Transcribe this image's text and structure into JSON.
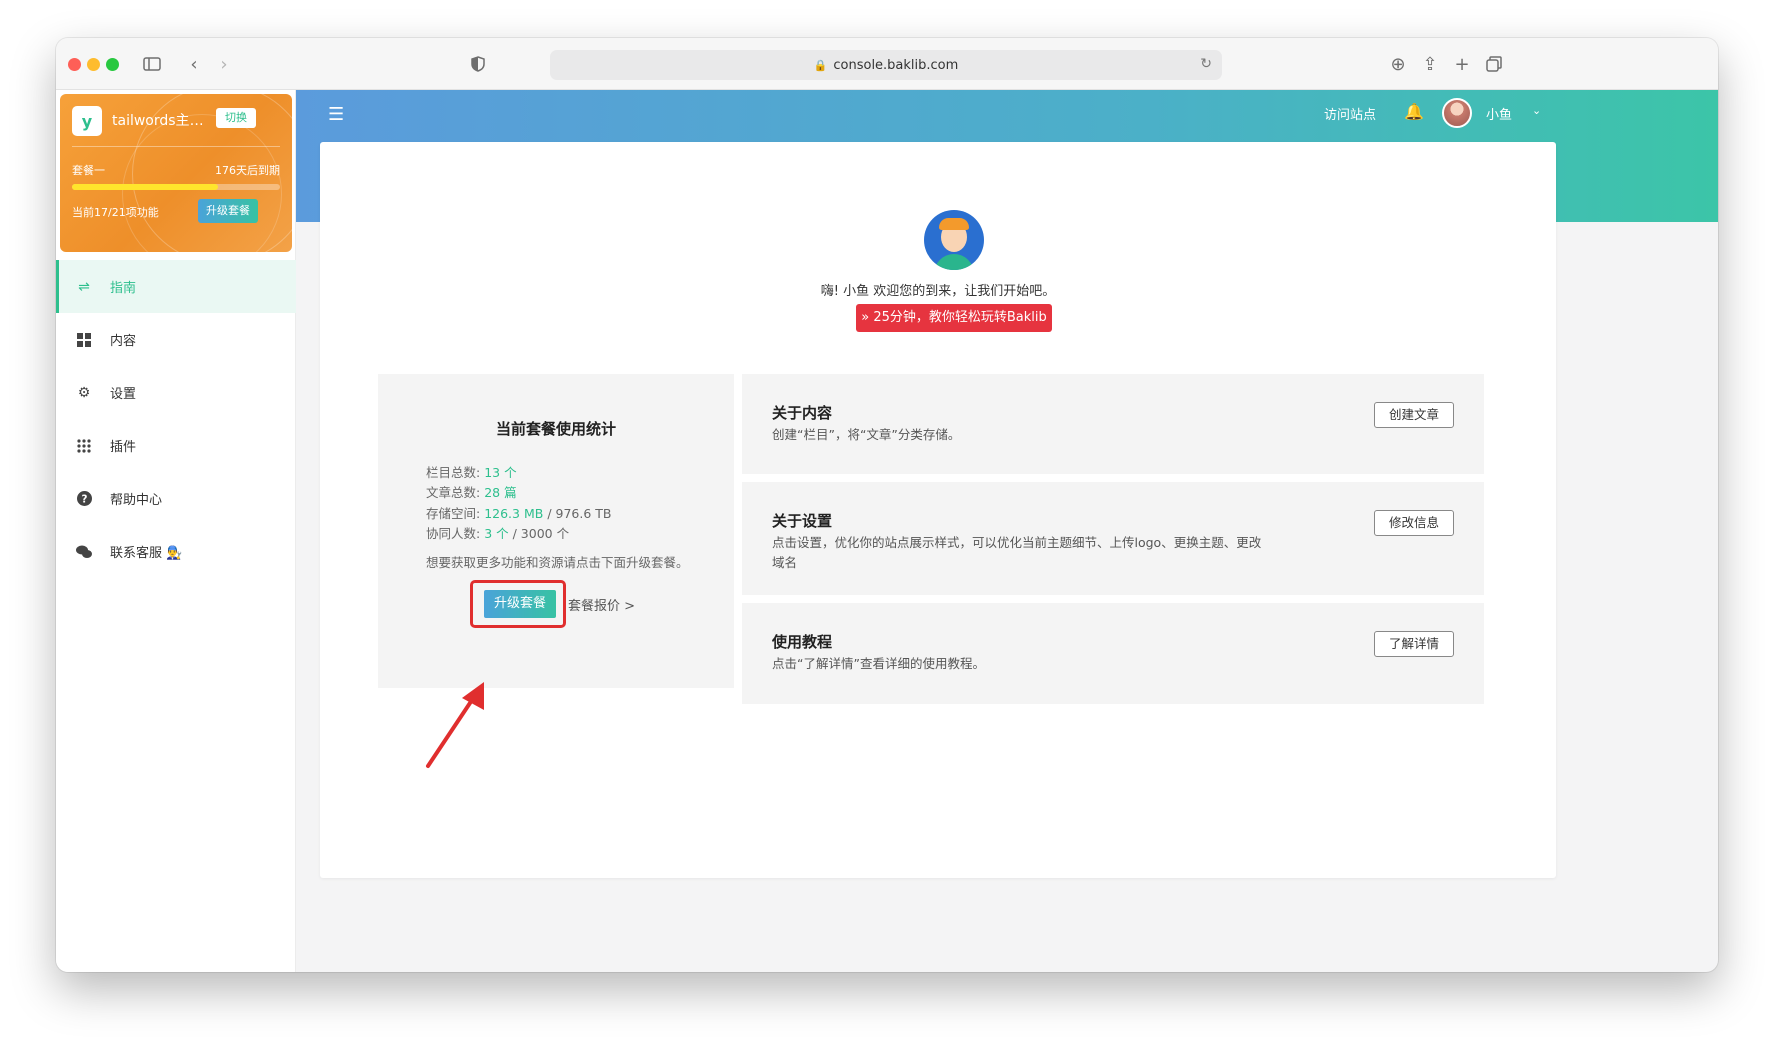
{
  "browser": {
    "url": "console.baklib.com"
  },
  "sidebar": {
    "site": {
      "logo_text": "y",
      "name": "tailwords主题...",
      "switch_label": "切换"
    },
    "plan": {
      "name": "套餐一",
      "expire_text": "176天后到期",
      "usage_fraction": 0.7,
      "features_text": "当前17/21项功能",
      "upgrade_label": "升级套餐"
    },
    "items": [
      {
        "label": "指南",
        "icon": "signpost-icon",
        "glyph": "⇌"
      },
      {
        "label": "内容",
        "icon": "grid-icon",
        "glyph": "▦"
      },
      {
        "label": "设置",
        "icon": "gear-icon",
        "glyph": "⚙"
      },
      {
        "label": "插件",
        "icon": "apps-icon",
        "glyph": "⁞⁞⁞"
      },
      {
        "label": "帮助中心",
        "icon": "help-icon",
        "glyph": "?"
      },
      {
        "label": "联系客服 👨‍🔧",
        "icon": "chat-icon",
        "glyph": "💬"
      }
    ]
  },
  "header": {
    "visit_site": "访问站点",
    "username": "小鱼"
  },
  "welcome": {
    "text": "嗨! 小鱼 欢迎您的到来，让我们开始吧。",
    "tutorial_button": "» 25分钟，教你轻松玩转Baklib"
  },
  "stats": {
    "title": "当前套餐使用统计",
    "rows": [
      {
        "label": "栏目总数:",
        "value": "13 个",
        "total": ""
      },
      {
        "label": "文章总数:",
        "value": "28 篇",
        "total": ""
      },
      {
        "label": "存储空间:",
        "value": "126.3 MB",
        "total": " / 976.6 TB"
      },
      {
        "label": "协同人数:",
        "value": "3 个",
        "total": " / 3000 个"
      }
    ],
    "hint": "想要获取更多功能和资源请点击下面升级套餐。",
    "upgrade_button": "升级套餐",
    "pricing_link": "套餐报价 >"
  },
  "cards": [
    {
      "title": "关于内容",
      "desc": "创建“栏目”，将“文章”分类存储。",
      "button": "创建文章"
    },
    {
      "title": "关于设置",
      "desc": "点击设置，优化你的站点展示样式，可以优化当前主题细节、上传logo、更换主题、更改域名",
      "button": "修改信息"
    },
    {
      "title": "使用教程",
      "desc": "点击“了解详情”查看详细的使用教程。",
      "button": "了解详情"
    }
  ],
  "colors": {
    "accent": "#2dbf8d",
    "plan_card": "#f39a2c",
    "tutorial": "#e6343f",
    "highlight": "#e02e2e"
  }
}
